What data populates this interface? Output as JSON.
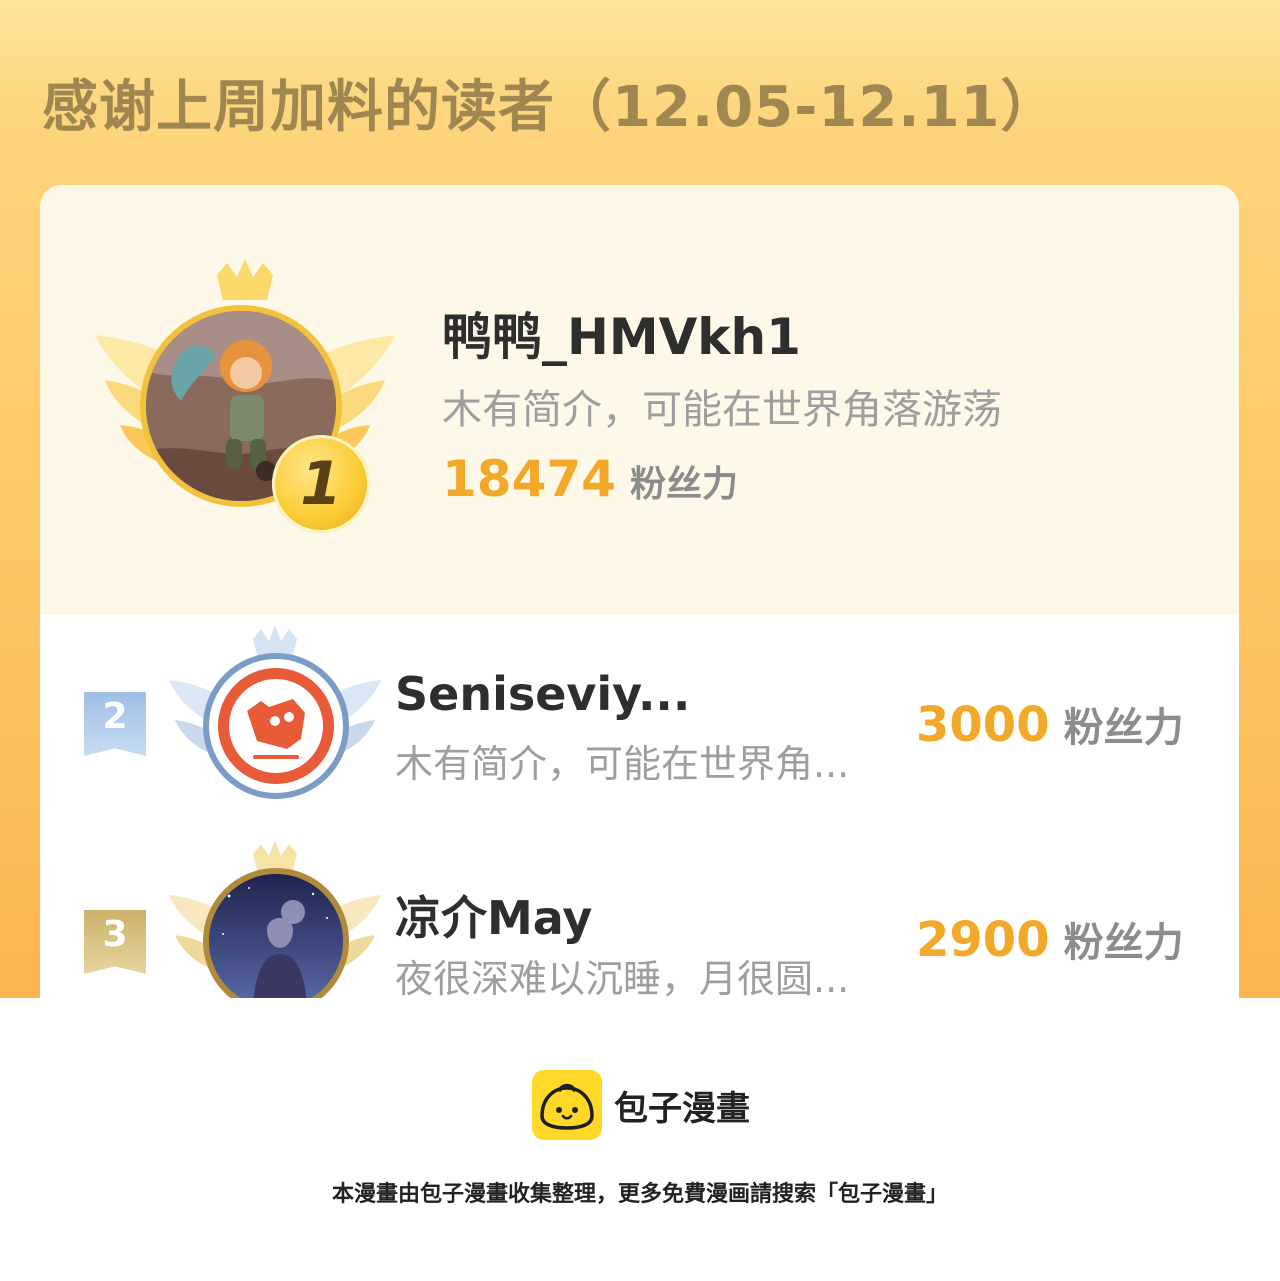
{
  "page": {
    "title": "感谢上周加料的读者（12.05-12.11）"
  },
  "colors": {
    "accent_gold": "#f2a92a",
    "background_gold": "#fcc765",
    "card_champion_bg": "#fdf8e7",
    "rank2_flag": "#a9c6e6",
    "rank3_flag": "#d9c48a"
  },
  "champion": {
    "rank": "1",
    "name": "鸭鸭_HMVkh1",
    "bio": "木有简介，可能在世界角落游荡",
    "fans_value": "18474",
    "fans_unit": "粉丝力",
    "avatar_icon": "avatar-illustration-icon",
    "badge_icon": "crown-wings-icon"
  },
  "ranking": [
    {
      "rank": "2",
      "name": "Seniseviy...",
      "bio": "木有简介，可能在世界角...",
      "fans_value": "3000",
      "fans_unit": "粉丝力",
      "avatar_icon": "default-avatar-icon"
    },
    {
      "rank": "3",
      "name": "凉介May",
      "bio": "夜很深难以沉睡，月很圆...",
      "fans_value": "2900",
      "fans_unit": "粉丝力",
      "avatar_icon": "night-sky-avatar-icon"
    }
  ],
  "brand": {
    "name": "包子漫畫",
    "logo_icon": "bun-logo-icon"
  },
  "footer": {
    "note": "本漫畫由包子漫畫收集整理，更多免費漫画請搜索「包子漫畫」"
  }
}
